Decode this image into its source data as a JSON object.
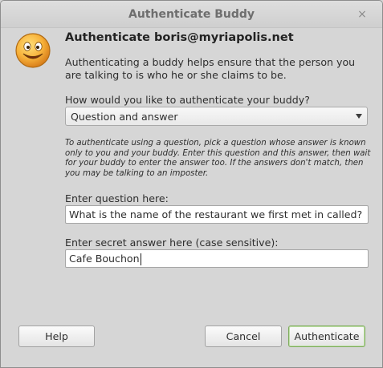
{
  "window": {
    "title": "Authenticate Buddy",
    "close_glyph": "×",
    "icon": "smiley-face-icon"
  },
  "dialog": {
    "heading": "Authenticate boris@myriapolis.net",
    "intro": "Authenticating a buddy helps ensure that the person you are talking to is who he or she claims to be.",
    "method_prompt": "How would you like to authenticate your buddy?",
    "method_selected": "Question and answer",
    "help_text": "To authenticate using a question, pick a question whose answer is known only to you and your buddy.  Enter this question and this answer, then wait for your buddy to enter the answer too.  If the answers don't match, then you may be talking to an imposter.",
    "question_label": "Enter question here:",
    "question_value": "What is the name of the restaurant we first met in called?",
    "answer_label": "Enter secret answer here (case sensitive):",
    "answer_value": "Cafe Bouchon"
  },
  "buttons": {
    "help": "Help",
    "cancel": "Cancel",
    "authenticate": "Authenticate"
  },
  "colors": {
    "window_bg": "#d6d6d6",
    "default_button_border": "#7dab5b",
    "smiley_face": "#f5a623"
  }
}
